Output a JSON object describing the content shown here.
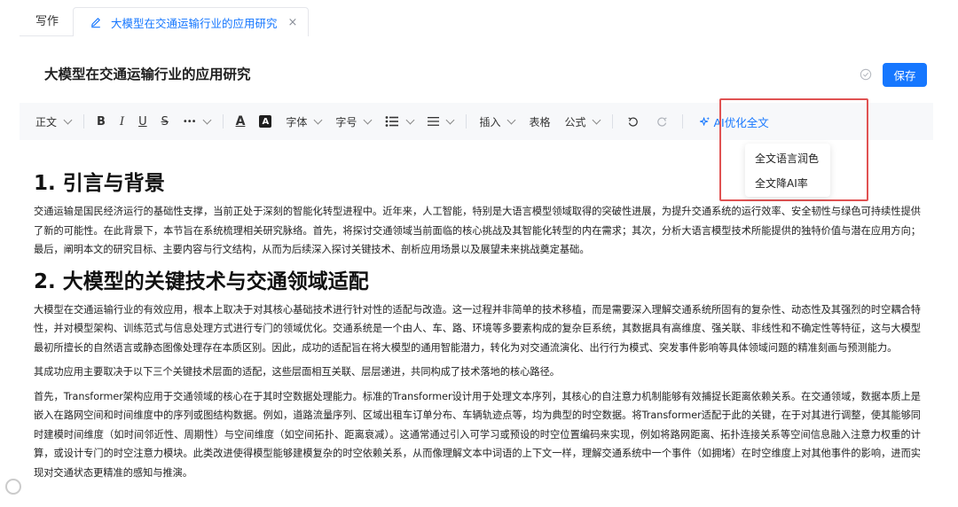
{
  "tabs": {
    "plain": "写作",
    "active": "大模型在交通运输行业的应用研究",
    "close": "×"
  },
  "header": {
    "title": "大模型在交通运输行业的应用研究",
    "save_label": "保存"
  },
  "toolbar": {
    "paragraph": "正文",
    "bold": "B",
    "italic": "I",
    "underline": "U",
    "strike": "S",
    "more": "•••",
    "font_color": "A",
    "font_bg": "A",
    "font_family": "字体",
    "font_size": "字号",
    "insert": "插入",
    "table": "表格",
    "formula": "公式",
    "ai_optimize": "AI优化全文"
  },
  "ai_menu": {
    "items": [
      "全文语言润色",
      "全文降AI率"
    ]
  },
  "content": {
    "h1": "1. 引言与背景",
    "p1": "交通运输是国民经济运行的基础性支撑，当前正处于深刻的智能化转型进程中。近年来，人工智能，特别是大语言模型领域取得的突破性进展，为提升交通系统的运行效率、安全韧性与绿色可持续性提供了新的可能性。在此背景下，本节旨在系统梳理相关研究脉络。首先，将探讨交通领域当前面临的核心挑战及其智能化转型的内在需求；其次，分析大语言模型技术所能提供的独特价值与潜在应用方向；最后，阐明本文的研究目标、主要内容与行文结构，从而为后续深入探讨关键技术、剖析应用场景以及展望未来挑战奠定基础。",
    "h2": "2. 大模型的关键技术与交通领域适配",
    "p2": "大模型在交通运输行业的有效应用，根本上取决于对其核心基础技术进行针对性的适配与改造。这一过程并非简单的技术移植，而是需要深入理解交通系统所固有的复杂性、动态性及其强烈的时空耦合特性，并对模型架构、训练范式与信息处理方式进行专门的领域优化。交通系统是一个由人、车、路、环境等多要素构成的复杂巨系统，其数据具有高维度、强关联、非线性和不确定性等特征，这与大模型最初所擅长的自然语言或静态图像处理存在本质区别。因此，成功的适配旨在将大模型的通用智能潜力，转化为对交通流演化、出行行为模式、突发事件影响等具体领域问题的精准刻画与预测能力。",
    "p3": "其成功应用主要取决于以下三个关键技术层面的适配，这些层面相互关联、层层递进，共同构成了技术落地的核心路径。",
    "p4": "首先，Transformer架构应用于交通领域的核心在于其时空数据处理能力。标准的Transformer设计用于处理文本序列，其核心的自注意力机制能够有效捕捉长距离依赖关系。在交通领域，数据本质上是嵌入在路网空间和时间维度中的序列或图结构数据。例如，道路流量序列、区域出租车订单分布、车辆轨迹点等，均为典型的时空数据。将Transformer适配于此的关键，在于对其进行调整，使其能够同时建模时间维度（如时间邻近性、周期性）与空间维度（如空间拓扑、距离衰减）。这通常通过引入可学习或预设的时空位置编码来实现，例如将路网距离、拓扑连接关系等空间信息融入注意力权重的计算，或设计专门的时空注意力模块。此类改进使得模型能够建模复杂的时空依赖关系，从而像理解文本中词语的上下文一样，理解交通系统中一个事件（如拥堵）在时空维度上对其他事件的影响，进而实现对交通状态更精准的感知与推演。"
  },
  "colors": {
    "accent": "#1677ff",
    "highlight": "#e05252"
  }
}
